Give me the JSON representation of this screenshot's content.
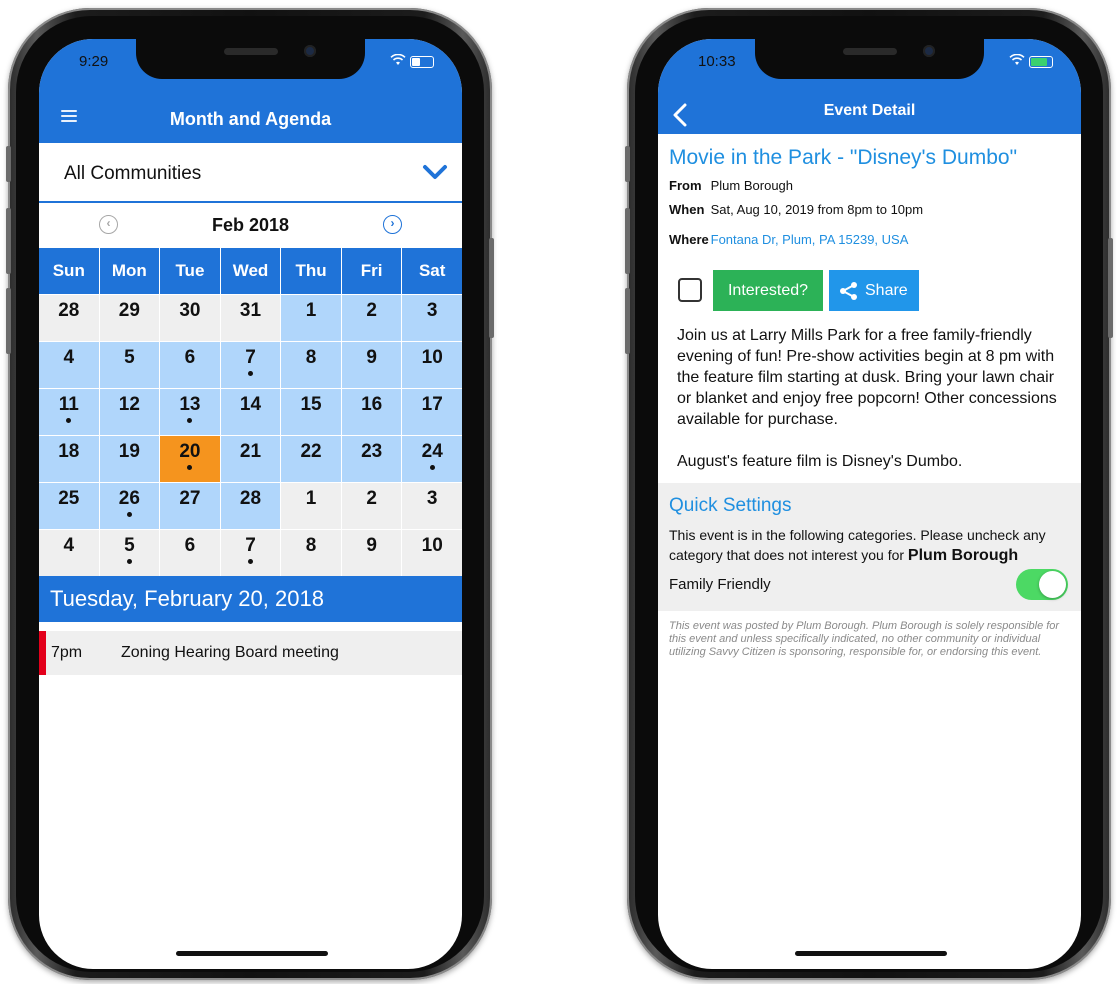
{
  "left": {
    "status_time": "9:29",
    "nav_title": "Month and Agenda",
    "community": "All Communities",
    "month": "Feb 2018",
    "prev_glyph": "‹",
    "next_glyph": "›",
    "weekdays": [
      "Sun",
      "Mon",
      "Tue",
      "Wed",
      "Thu",
      "Fri",
      "Sat"
    ],
    "days": [
      {
        "d": "28",
        "s": "out",
        "dot": false
      },
      {
        "d": "29",
        "s": "out",
        "dot": false
      },
      {
        "d": "30",
        "s": "out",
        "dot": false
      },
      {
        "d": "31",
        "s": "out",
        "dot": false
      },
      {
        "d": "1",
        "s": "in",
        "dot": false
      },
      {
        "d": "2",
        "s": "in",
        "dot": false
      },
      {
        "d": "3",
        "s": "in",
        "dot": false
      },
      {
        "d": "4",
        "s": "in",
        "dot": false
      },
      {
        "d": "5",
        "s": "in",
        "dot": false
      },
      {
        "d": "6",
        "s": "in",
        "dot": false
      },
      {
        "d": "7",
        "s": "in",
        "dot": true
      },
      {
        "d": "8",
        "s": "in",
        "dot": false
      },
      {
        "d": "9",
        "s": "in",
        "dot": false
      },
      {
        "d": "10",
        "s": "in",
        "dot": false
      },
      {
        "d": "11",
        "s": "in",
        "dot": true
      },
      {
        "d": "12",
        "s": "in",
        "dot": false
      },
      {
        "d": "13",
        "s": "in",
        "dot": true
      },
      {
        "d": "14",
        "s": "in",
        "dot": false
      },
      {
        "d": "15",
        "s": "in",
        "dot": false
      },
      {
        "d": "16",
        "s": "in",
        "dot": false
      },
      {
        "d": "17",
        "s": "in",
        "dot": false
      },
      {
        "d": "18",
        "s": "in",
        "dot": false
      },
      {
        "d": "19",
        "s": "in",
        "dot": false
      },
      {
        "d": "20",
        "s": "today",
        "dot": true
      },
      {
        "d": "21",
        "s": "in",
        "dot": false
      },
      {
        "d": "22",
        "s": "in",
        "dot": false
      },
      {
        "d": "23",
        "s": "in",
        "dot": false
      },
      {
        "d": "24",
        "s": "in",
        "dot": true
      },
      {
        "d": "25",
        "s": "in",
        "dot": false
      },
      {
        "d": "26",
        "s": "in",
        "dot": true
      },
      {
        "d": "27",
        "s": "in",
        "dot": false
      },
      {
        "d": "28",
        "s": "in",
        "dot": false
      },
      {
        "d": "1",
        "s": "out",
        "dot": false
      },
      {
        "d": "2",
        "s": "out",
        "dot": false
      },
      {
        "d": "3",
        "s": "out",
        "dot": false
      },
      {
        "d": "4",
        "s": "out",
        "dot": false
      },
      {
        "d": "5",
        "s": "out",
        "dot": true
      },
      {
        "d": "6",
        "s": "out",
        "dot": false
      },
      {
        "d": "7",
        "s": "out",
        "dot": true
      },
      {
        "d": "8",
        "s": "out",
        "dot": false
      },
      {
        "d": "9",
        "s": "out",
        "dot": false
      },
      {
        "d": "10",
        "s": "out",
        "dot": false
      }
    ],
    "selected_day": "Tuesday, February 20, 2018",
    "agenda": [
      {
        "time": "7pm",
        "title": "Zoning Hearing Board meeting",
        "color": "#e3001b"
      }
    ]
  },
  "right": {
    "status_time": "10:33",
    "nav_title": "Event Detail",
    "event_title": "Movie in the Park - \"Disney's Dumbo\"",
    "from_label": "From",
    "from_value": "Plum Borough",
    "when_label": "When",
    "when_value": "Sat, Aug 10, 2019 from 8pm to 10pm",
    "where_label": "Where",
    "where_value": "Fontana Dr, Plum, PA 15239, USA",
    "interested_label": "Interested?",
    "share_label": "Share",
    "description_p1": "Join us at Larry Mills Park for a free family-friendly evening of fun! Pre-show activities begin at 8 pm with the feature film starting at dusk. Bring your lawn chair or blanket and enjoy free popcorn! Other concessions available for purchase.",
    "description_p2": "August's feature film is Disney's Dumbo.",
    "quick_title": "Quick Settings",
    "quick_desc": "This event is in the following categories. Please uncheck any category that does not interest you for",
    "quick_org": "Plum Borough",
    "category": "Family Friendly",
    "category_enabled": true,
    "disclaimer": "This event was posted by Plum Borough. Plum Borough is solely responsible for this event and unless specifically indicated, no other community or individual utilizing Savvy Citizen is sponsoring, responsible for, or endorsing this event."
  },
  "colors": {
    "primary": "#1f73d8",
    "today": "#f5941e",
    "month_day": "#b0d6fb",
    "other_day": "#efefef",
    "interested": "#2cb257",
    "share": "#2196ea",
    "link": "#1f8fe0"
  },
  "icons": [
    "menu-icon",
    "chevron-down-icon",
    "prev-month-icon",
    "next-month-icon",
    "back-chevron-icon",
    "share-icon",
    "wifi-icon",
    "battery-icon"
  ]
}
